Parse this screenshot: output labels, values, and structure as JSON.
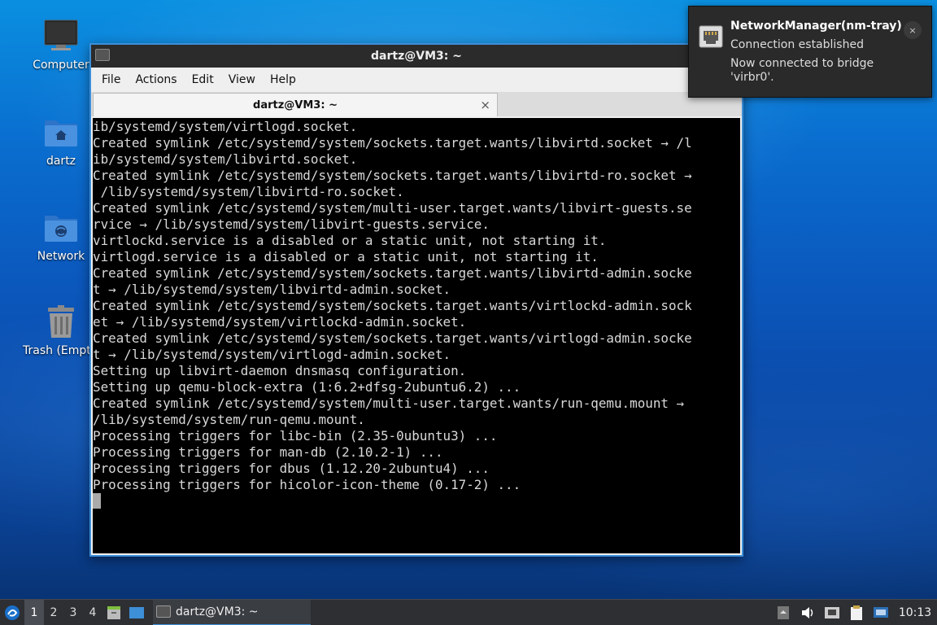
{
  "desktop": {
    "icons": [
      {
        "label": "Computer",
        "icon": "computer-monitor-icon"
      },
      {
        "label": "dartz",
        "icon": "home-folder-icon"
      },
      {
        "label": "Network",
        "icon": "network-folder-icon"
      },
      {
        "label": "Trash (Empty)",
        "icon": "trash-icon"
      }
    ]
  },
  "window": {
    "title": "dartz@VM3: ~",
    "menu": [
      "File",
      "Actions",
      "Edit",
      "View",
      "Help"
    ],
    "tab_label": "dartz@VM3: ~",
    "tab_close": "×",
    "terminal_lines": [
      "ib/systemd/system/virtlogd.socket.",
      "Created symlink /etc/systemd/system/sockets.target.wants/libvirtd.socket → /l",
      "ib/systemd/system/libvirtd.socket.",
      "Created symlink /etc/systemd/system/sockets.target.wants/libvirtd-ro.socket →",
      " /lib/systemd/system/libvirtd-ro.socket.",
      "Created symlink /etc/systemd/system/multi-user.target.wants/libvirt-guests.se",
      "rvice → /lib/systemd/system/libvirt-guests.service.",
      "virtlockd.service is a disabled or a static unit, not starting it.",
      "virtlogd.service is a disabled or a static unit, not starting it.",
      "Created symlink /etc/systemd/system/sockets.target.wants/libvirtd-admin.socke",
      "t → /lib/systemd/system/libvirtd-admin.socket.",
      "Created symlink /etc/systemd/system/sockets.target.wants/virtlockd-admin.sock",
      "et → /lib/systemd/system/virtlockd-admin.socket.",
      "Created symlink /etc/systemd/system/sockets.target.wants/virtlogd-admin.socke",
      "t → /lib/systemd/system/virtlogd-admin.socket.",
      "Setting up libvirt-daemon dnsmasq configuration.",
      "Setting up qemu-block-extra (1:6.2+dfsg-2ubuntu6.2) ...",
      "Created symlink /etc/systemd/system/multi-user.target.wants/run-qemu.mount →",
      "/lib/systemd/system/run-qemu.mount.",
      "Processing triggers for libc-bin (2.35-0ubuntu3) ...",
      "Processing triggers for man-db (2.10.2-1) ...",
      "Processing triggers for dbus (1.12.20-2ubuntu4) ...",
      "Processing triggers for hicolor-icon-theme (0.17-2) ..."
    ]
  },
  "notification": {
    "app": "NetworkManager(nm-tray)",
    "summary": "Connection established",
    "body": "Now connected to bridge 'virbr0'.",
    "close": "×"
  },
  "taskbar": {
    "workspaces": [
      "1",
      "2",
      "3",
      "4"
    ],
    "active_workspace": "1",
    "task_label": "dartz@VM3: ~",
    "clock": "10:13"
  },
  "colors": {
    "accent": "#3d8fd8",
    "terminal_bg": "#000000",
    "panel_bg": "#2d2f33"
  }
}
